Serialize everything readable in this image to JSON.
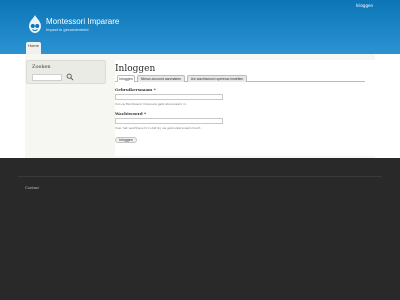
{
  "header": {
    "top_link": "Inloggen",
    "site_name": "Montessori Imparare",
    "slogan": "Impact in gezondenheid",
    "nav": {
      "home": "Home"
    }
  },
  "sidebar": {
    "title": "Zoeken",
    "search_placeholder": ""
  },
  "main": {
    "title": "Inloggen",
    "tabs": [
      {
        "label": "Inloggen"
      },
      {
        "label": "Nieuw account aanmaken"
      },
      {
        "label": "Uw wachtwoord opnieuw instellen"
      }
    ],
    "username": {
      "label": "Gebruikersnaam *",
      "value": "",
      "description": "Vul uw Montessori Imparare gebruikersnaam in."
    },
    "password": {
      "label": "Wachtwoord *",
      "value": "",
      "description": "Voer het wachtwoord in dat bij uw gebruikersnaam hoort."
    },
    "submit_label": "Inloggen"
  },
  "footer": {
    "contact": "Contact"
  },
  "colors": {
    "header_top": "#0b75b6",
    "header_bottom": "#2c93d3",
    "footer": "#292929"
  },
  "icons": {
    "logo": "drupal-logo-icon",
    "search": "search-icon"
  }
}
